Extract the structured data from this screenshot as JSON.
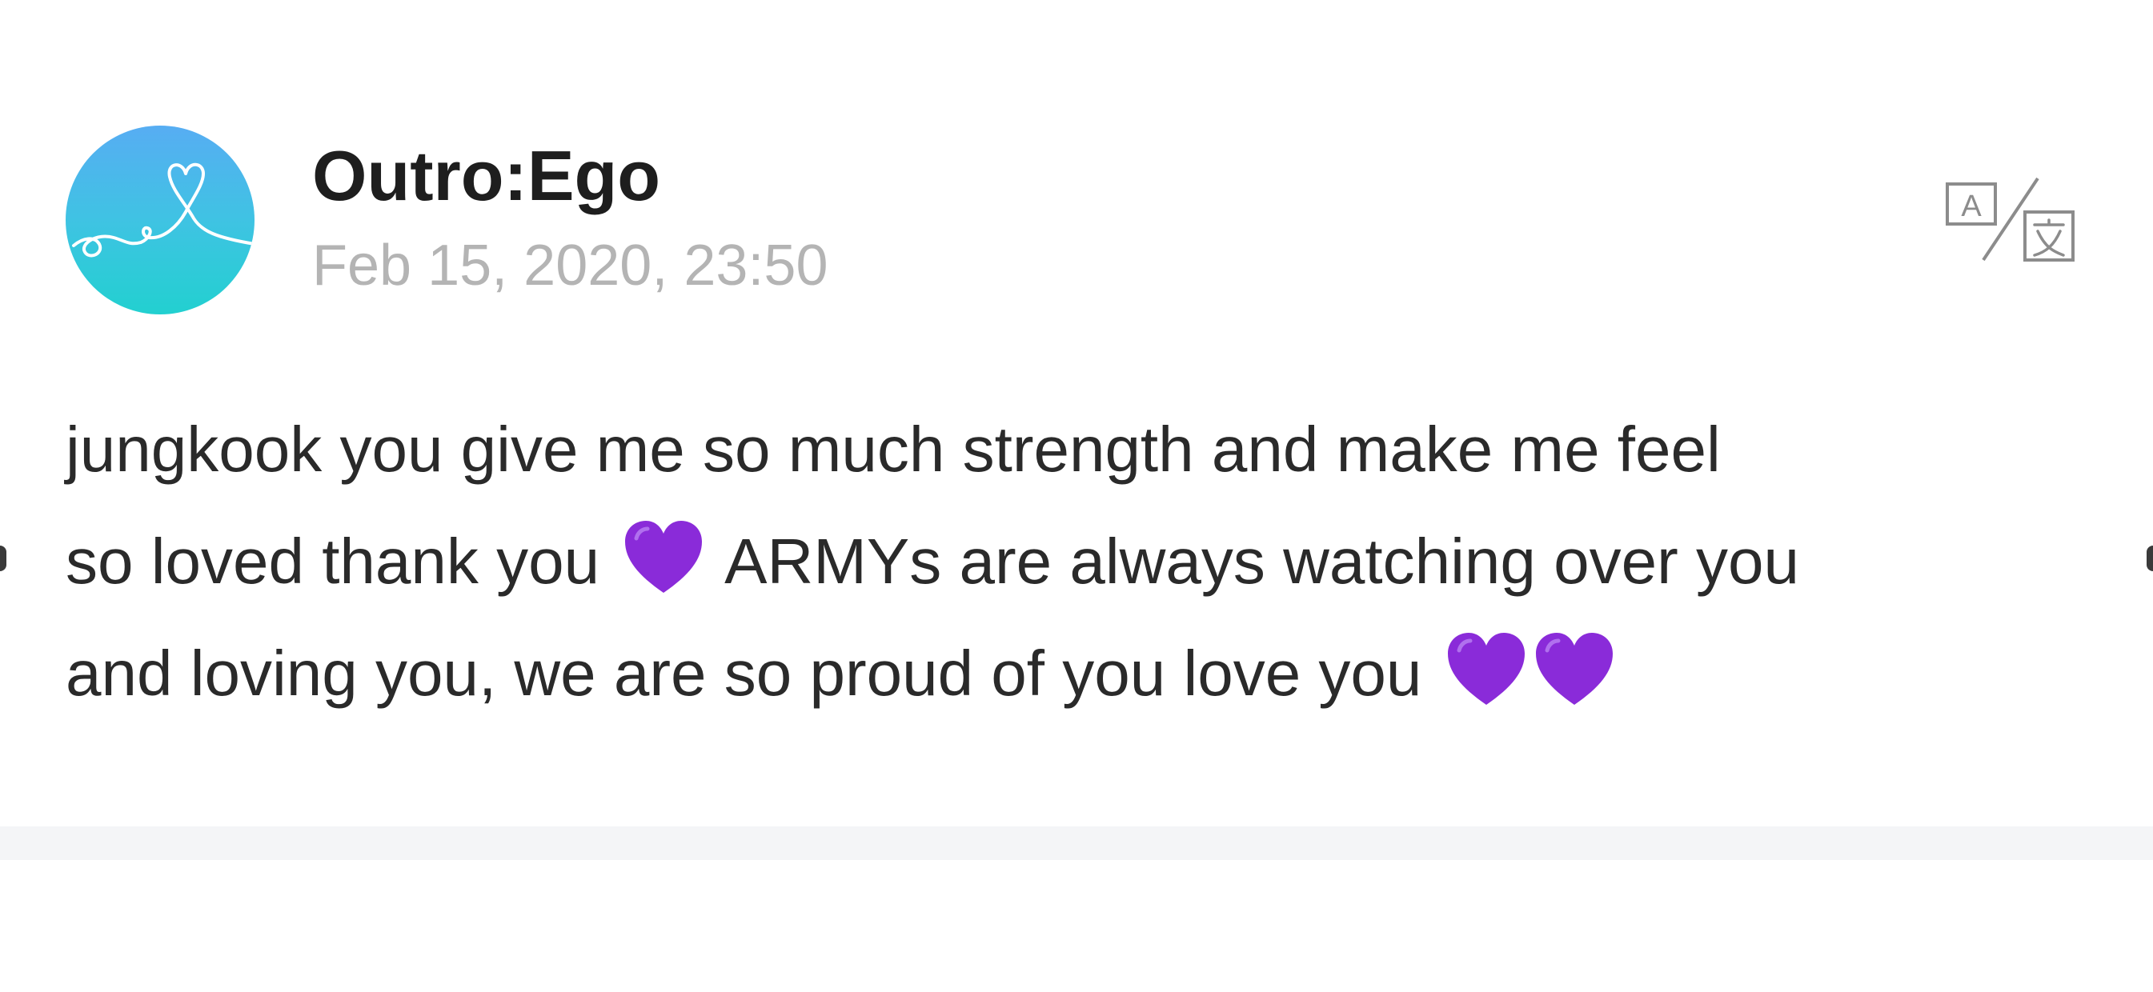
{
  "post": {
    "author": "Outro:Ego",
    "timestamp": "Feb 15, 2020, 23:50",
    "body_lines": [
      "jungkook you give me so much strength and make me feel",
      "so loved thank you",
      "ARMYs are always watching over you",
      "and loving you, we are so proud of you love you"
    ],
    "heart_emoji": "💜"
  },
  "icons": {
    "avatar": "heart-doodle-avatar",
    "translate": "translate-icon",
    "heart": "purple-heart-icon"
  },
  "colors": {
    "author_text": "#1e1e1e",
    "timestamp_text": "#b4b4b4",
    "body_text": "#2a2a2a",
    "heart": "#8a2bd9",
    "avatar_top": "#57adf3",
    "avatar_bottom": "#22d0d0",
    "separator": "#f4f5f7"
  }
}
